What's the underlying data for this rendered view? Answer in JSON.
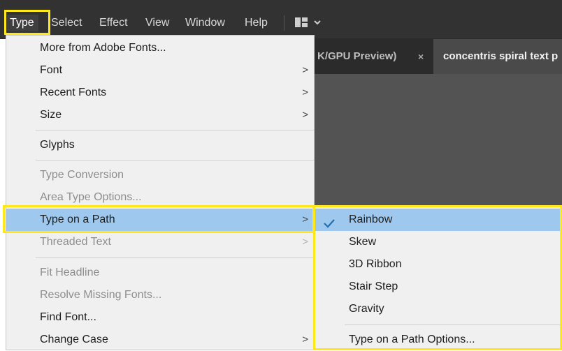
{
  "menubar": {
    "items": [
      {
        "label": "Type",
        "active": true
      },
      {
        "label": "Select"
      },
      {
        "label": "Effect"
      },
      {
        "label": "View"
      },
      {
        "label": "Window"
      },
      {
        "label": "Help"
      }
    ],
    "workspace_icon": "workspace-switcher-icon",
    "dropdown_icon": "chevron-down-icon"
  },
  "tabs": [
    {
      "label": "K/GPU Preview)",
      "close": "×",
      "active": false
    },
    {
      "label": "concentris spiral text p",
      "active": true
    }
  ],
  "type_menu": {
    "items": [
      {
        "label": "More from Adobe Fonts...",
        "enabled": true
      },
      {
        "label": "Font",
        "enabled": true,
        "submenu": true
      },
      {
        "label": "Recent Fonts",
        "enabled": true,
        "submenu": true
      },
      {
        "label": "Size",
        "enabled": true,
        "submenu": true
      },
      {
        "label": "Glyphs",
        "enabled": true
      },
      {
        "label": "Type Conversion",
        "enabled": false
      },
      {
        "label": "Area Type Options...",
        "enabled": false
      },
      {
        "label": "Type on a Path",
        "enabled": true,
        "submenu": true,
        "highlighted": true
      },
      {
        "label": "Threaded Text",
        "enabled": false,
        "submenu": true
      },
      {
        "label": "Fit Headline",
        "enabled": false
      },
      {
        "label": "Resolve Missing Fonts...",
        "enabled": false
      },
      {
        "label": "Find Font...",
        "enabled": true
      },
      {
        "label": "Change Case",
        "enabled": true,
        "submenu": true
      }
    ],
    "submenu_arrow": ">"
  },
  "type_on_path_submenu": {
    "items": [
      {
        "label": "Rainbow",
        "checked": true,
        "highlighted": true
      },
      {
        "label": "Skew"
      },
      {
        "label": "3D Ribbon"
      },
      {
        "label": "Stair Step"
      },
      {
        "label": "Gravity"
      },
      {
        "label": "Type on a Path Options..."
      }
    ]
  },
  "colors": {
    "menubar_bg": "#323232",
    "menu_bg": "#f0f0f0",
    "highlight_bg": "#9ec8ed",
    "callout_yellow": "#ffe81a",
    "check_color": "#1f6fb2"
  }
}
